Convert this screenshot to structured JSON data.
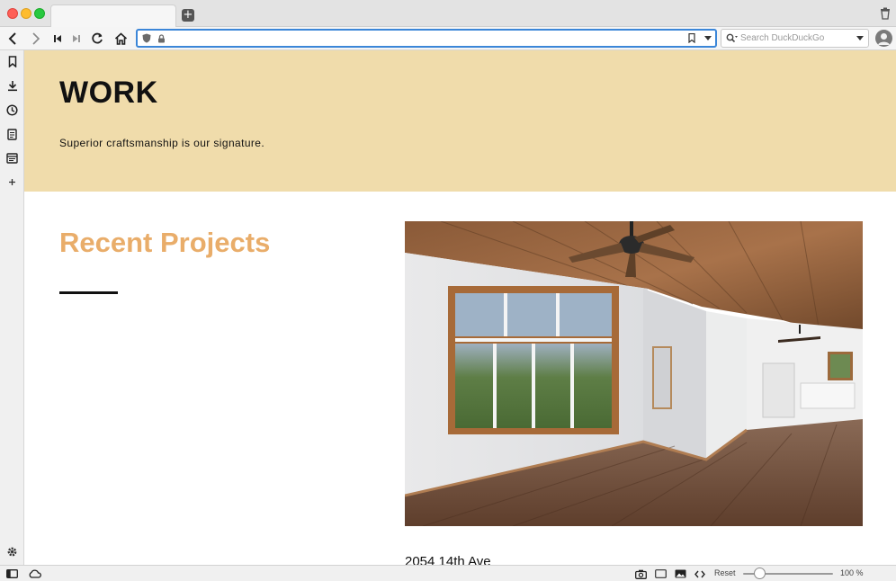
{
  "browser": {
    "search_placeholder": "Search DuckDuckGo",
    "zoom_reset_label": "Reset",
    "zoom_level": "100 %",
    "zoom_value": 100
  },
  "page": {
    "hero_title": "WORK",
    "hero_subtitle": "Superior craftsmanship is our signature.",
    "section_heading": "Recent Projects",
    "project_title": "2054 14th Ave",
    "colors": {
      "hero_background": "#f0dcab",
      "heading_accent": "#e9ad6a"
    }
  },
  "icons": {
    "toolbar": [
      "back-icon",
      "forward-icon",
      "rewind-icon",
      "fast-forward-icon",
      "reload-icon",
      "home-icon"
    ],
    "sidepanel": [
      "bookmarks-icon",
      "downloads-icon",
      "history-icon",
      "notes-icon",
      "window-icon",
      "add-panel-icon",
      "settings-icon"
    ],
    "statusbar": [
      "panel-toggle-icon",
      "sync-cloud-icon",
      "capture-icon",
      "tiling-icon",
      "images-icon",
      "page-actions-icon"
    ]
  }
}
